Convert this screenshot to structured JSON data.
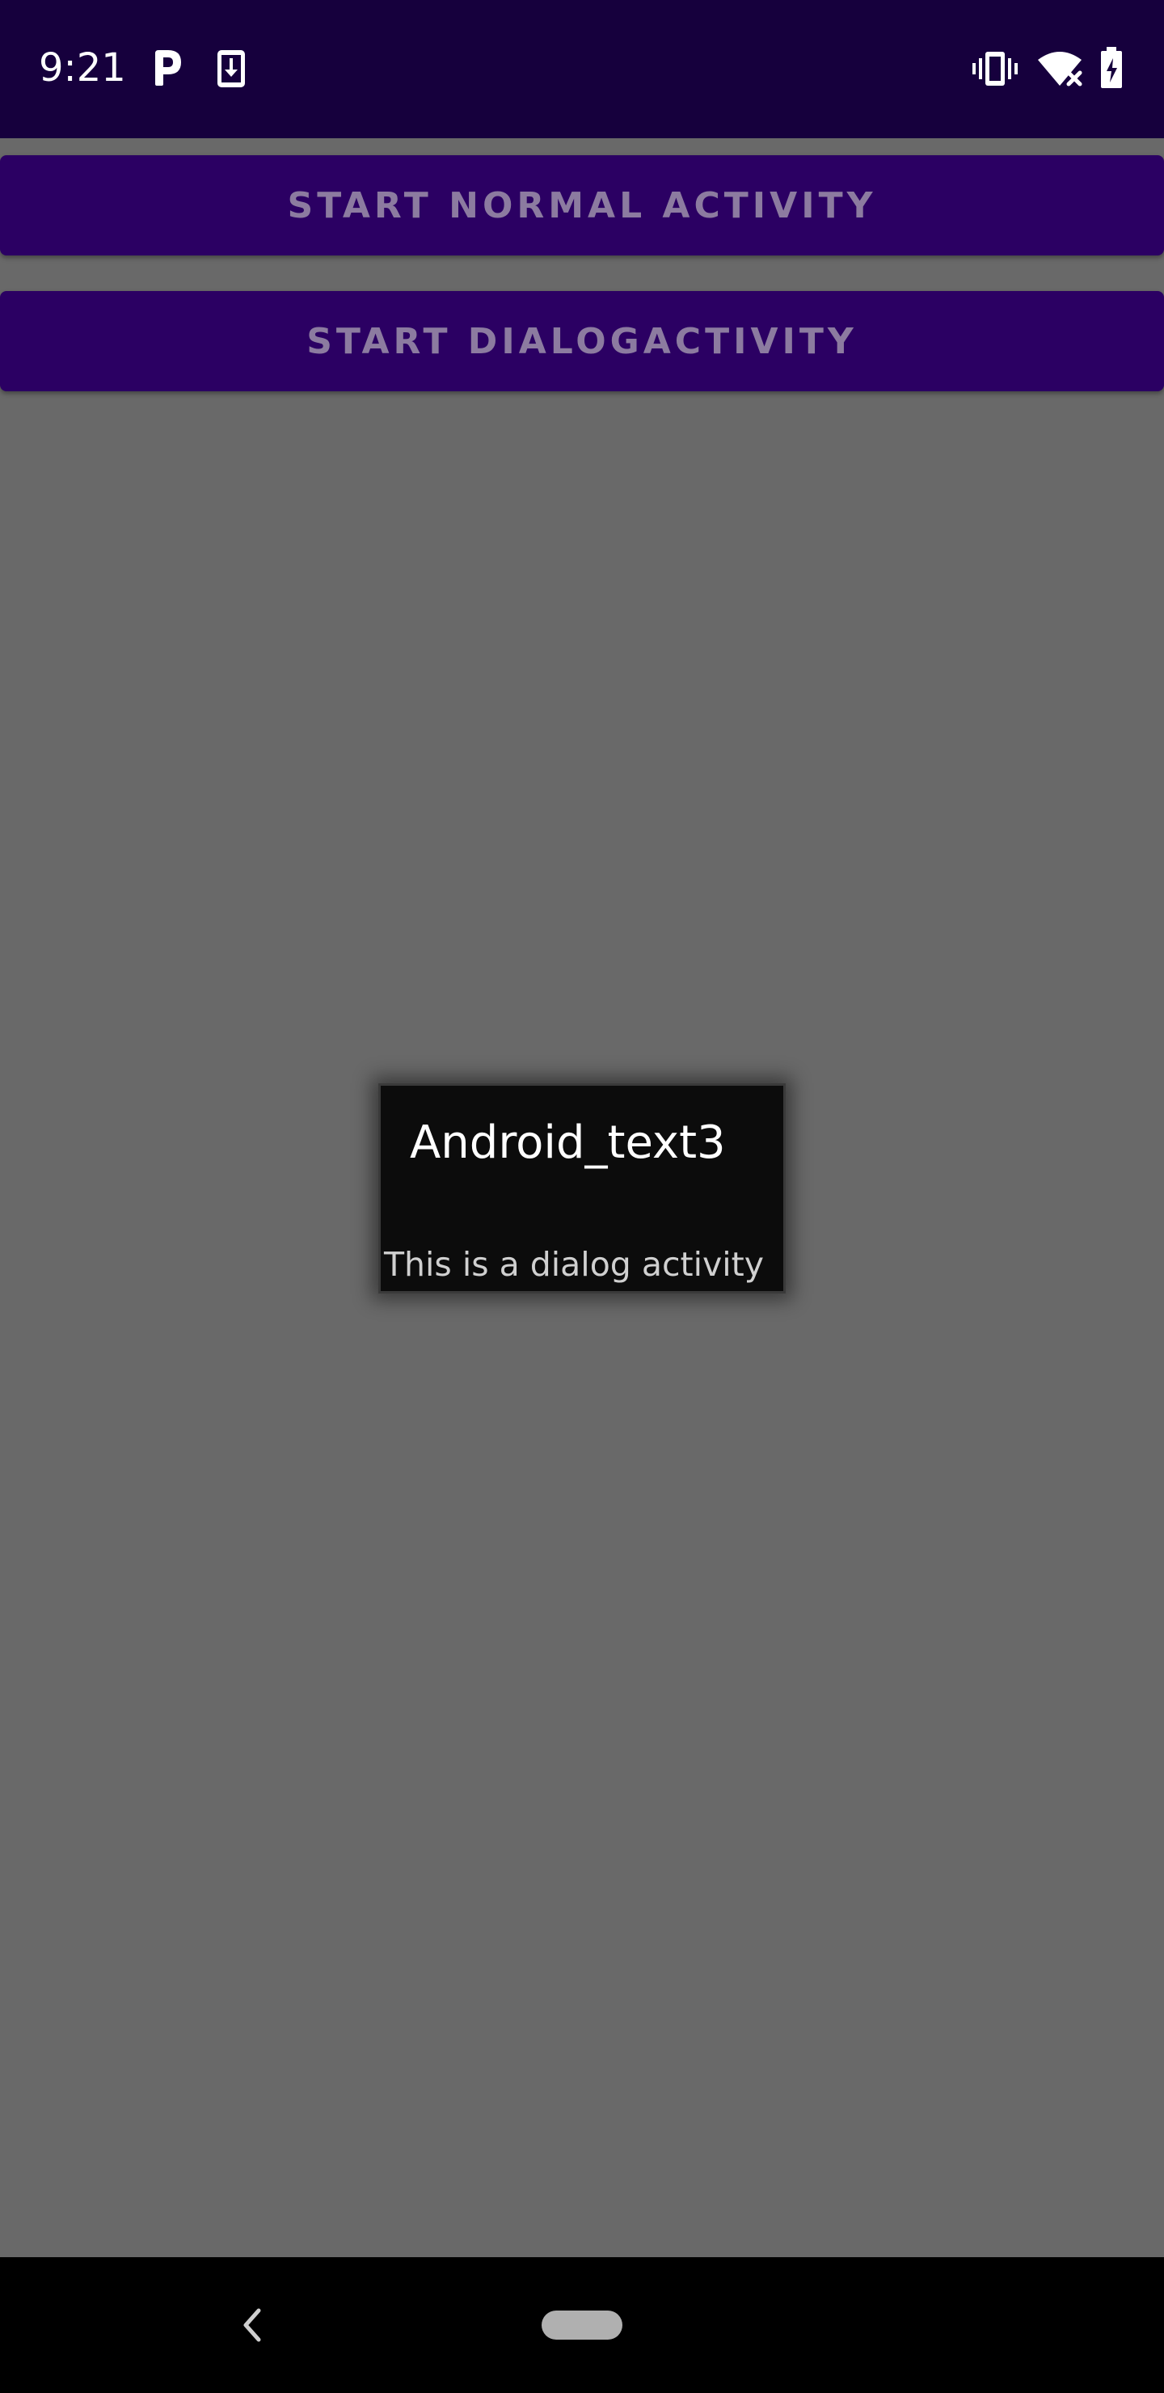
{
  "status_bar": {
    "time": "9:21",
    "icons_left": [
      "parking-icon",
      "download-icon"
    ],
    "icons_right": [
      "vibrate-icon",
      "wifi-off-icon",
      "battery-charging-icon"
    ],
    "background": "#16003d"
  },
  "main": {
    "buttons": [
      {
        "label": "START NORMAL ACTIVITY"
      },
      {
        "label": "START DIALOGACTIVITY"
      }
    ],
    "button_color": "#2b0063",
    "scrim_color": "#696969"
  },
  "dialog": {
    "title": "Android_text3",
    "message": "This is a dialog activity"
  },
  "nav_bar": {
    "icons": [
      "back-icon",
      "home-pill-icon"
    ]
  }
}
